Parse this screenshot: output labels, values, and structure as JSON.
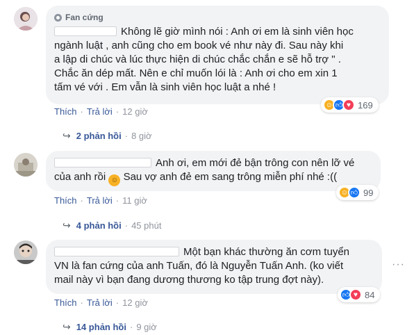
{
  "comments": [
    {
      "badge": "Fan cứng",
      "text_lines": [
        "Không lẽ giờ mình nói : Anh ơi em là sinh viên học",
        "ngành luật , anh cũng cho em book vé như này đi. Sau này khi",
        "a lập di chúc và lúc thực hiện di chúc chắc chắn e sẽ hỗ trợ \" .",
        "Chắc ăn dép mất. Nên e chỉ muốn lói là : Anh ơi cho em xin 1",
        "tấm vé với . Em vẫn là sinh viên học luật a nhé !"
      ],
      "like_label": "Thích",
      "reply_label": "Trả lời",
      "time": "12 giờ",
      "reaction_count": "169",
      "reactions": [
        "haha-icon",
        "like-icon",
        "love-icon"
      ],
      "replies_label": "2 phản hồi",
      "replies_time": "8 giờ"
    },
    {
      "text_lines": [
        "Anh ơi, em mới đẻ bận trông con nên lỡ vé",
        "của anh rồi",
        "Sau vợ anh đẻ em sang trông miễn phí nhé :(("
      ],
      "like_label": "Thích",
      "reply_label": "Trả lời",
      "time": "11 giờ",
      "reaction_count": "99",
      "reactions": [
        "haha-icon",
        "like-icon"
      ],
      "replies_label": "4 phản hồi",
      "replies_time": "45 phút"
    },
    {
      "text_lines": [
        "Một bạn khác thường ăn cơm tuyển",
        "VN là fan cứng của anh Tuấn, đó là Nguyễn Tuấn Anh. (ko viết",
        "mail này vì bạn đang dương thương ko tập trung đợt này)."
      ],
      "like_label": "Thích",
      "reply_label": "Trả lời",
      "time": "12 giờ",
      "reaction_count": "84",
      "reactions": [
        "like-icon",
        "love-icon"
      ],
      "replies_label": "14 phản hồi",
      "replies_time": "9 giờ",
      "more_label": "···"
    }
  ],
  "colors": {
    "link": "#385898",
    "muted": "#90949c",
    "bubble": "#f2f3f5",
    "like": "#1877f2",
    "love": "#f33e58",
    "haha": "#f7b125"
  }
}
